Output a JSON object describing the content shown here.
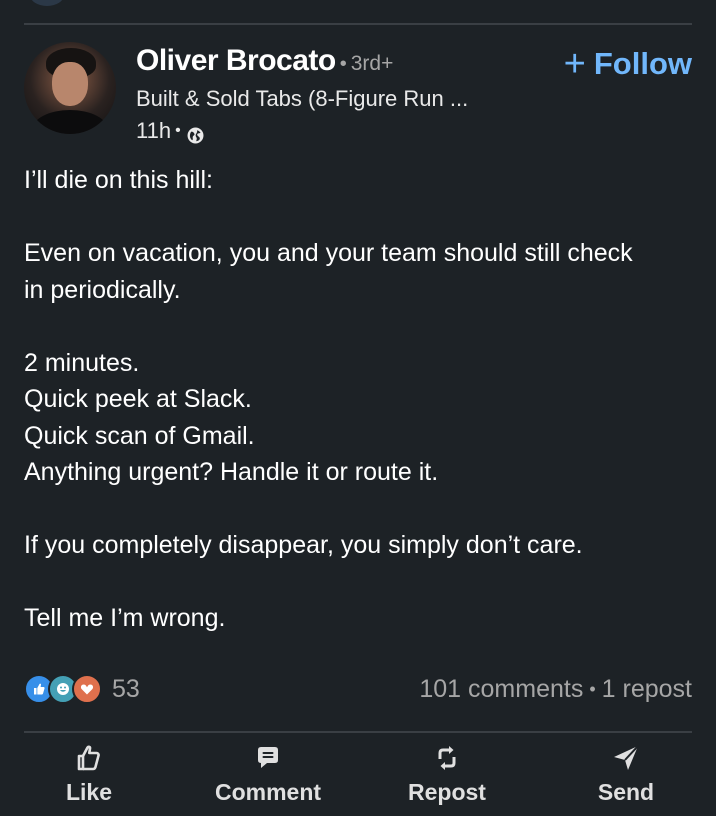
{
  "post": {
    "author": {
      "name": "Oliver Brocato",
      "degree": "3rd+",
      "headline": "Built & Sold Tabs (8-Figure Run ...",
      "time": "11h",
      "separator": "•"
    },
    "follow_label": "+ Follow",
    "follow_text": "Follow",
    "follow_plus": "+",
    "body_lines": [
      "I’ll die on this hill:",
      "",
      "Even on vacation, you and your team should still check",
      "in periodically.",
      "",
      "2 minutes.",
      "Quick peek at Slack.",
      "Quick scan of Gmail.",
      "Anything urgent? Handle it or route it.",
      "",
      "If you completely disappear, you simply don’t care.",
      "",
      "Tell me I’m wrong."
    ]
  },
  "social": {
    "reaction_count": "53",
    "reactions": [
      "like-icon",
      "celebrate-icon",
      "love-icon"
    ],
    "comments": "101 comments",
    "reposts": "1 repost",
    "separator": "•"
  },
  "actions": {
    "like": "Like",
    "comment": "Comment",
    "repost": "Repost",
    "send": "Send"
  },
  "colors": {
    "background": "#1d2226",
    "accent": "#71b7fb",
    "like": "#378fe9",
    "celebrate": "#44a0b5",
    "love": "#df704d"
  }
}
